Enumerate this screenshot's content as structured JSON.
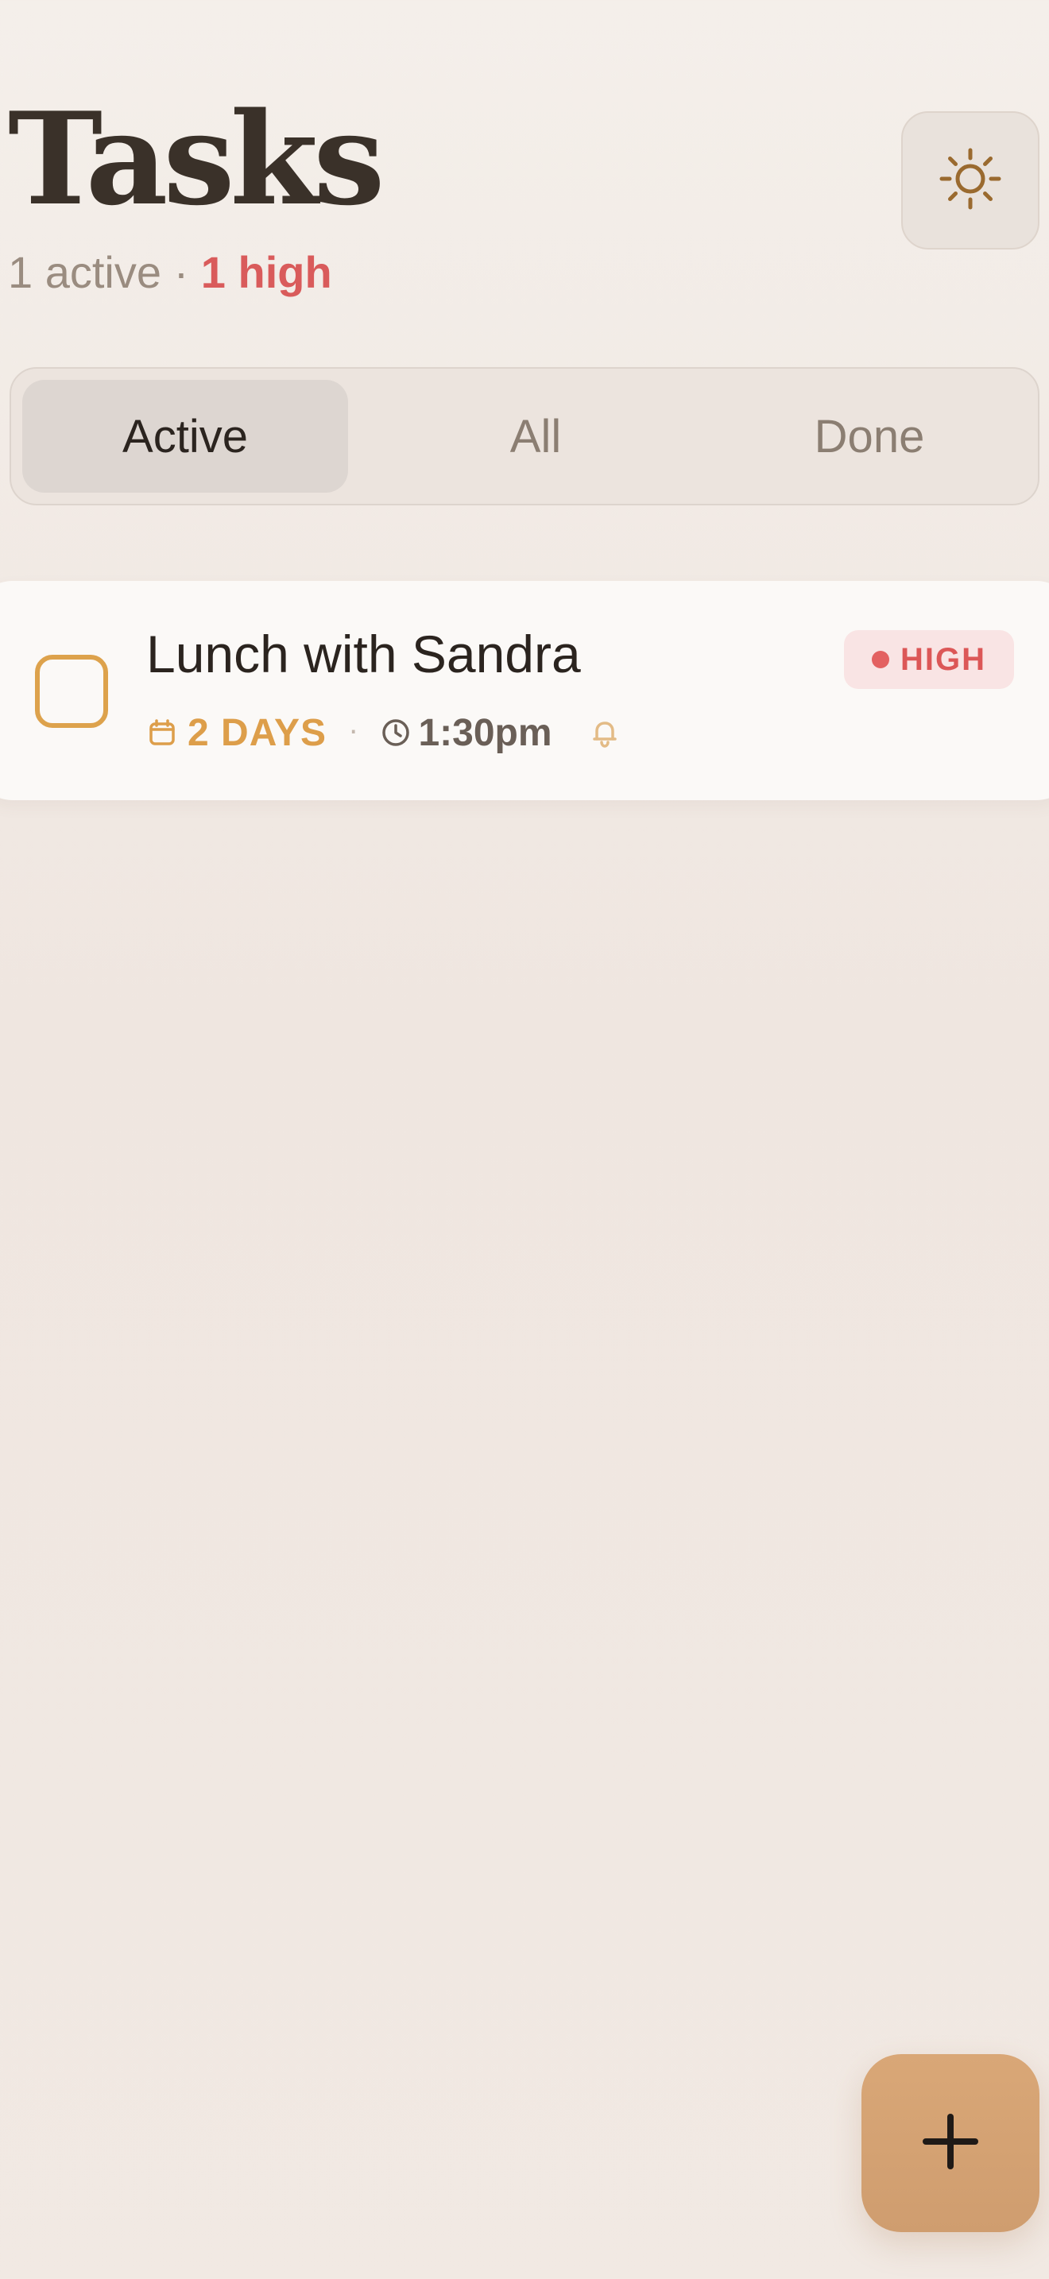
{
  "header": {
    "title": "Tasks",
    "active_count_text": "1 active",
    "separator": "·",
    "high_count_text": "1 high"
  },
  "theme_toggle": {
    "icon": "sun-icon"
  },
  "tabs": [
    {
      "label": "Active",
      "selected": true
    },
    {
      "label": "All",
      "selected": false
    },
    {
      "label": "Done",
      "selected": false
    }
  ],
  "tasks": [
    {
      "title": "Lunch with Sandra",
      "priority": "HIGH",
      "due": "2 DAYS",
      "meta_separator": "·",
      "time": "1:30pm",
      "reminder_icon": "bell-icon",
      "due_icon": "calendar-icon",
      "time_icon": "clock-icon"
    }
  ],
  "fab": {
    "icon": "plus-icon"
  },
  "colors": {
    "accent": "#dda24c",
    "high_priority": "#dc5757",
    "fab_background": "#d9a777"
  }
}
